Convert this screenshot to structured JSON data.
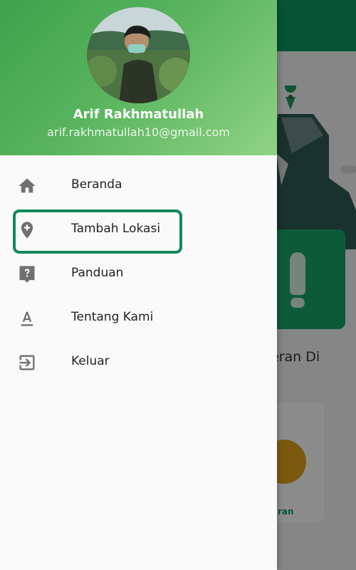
{
  "user": {
    "name": "Arif Rakhmatullah",
    "email": "arif.rakhmatullah10@gmail.com"
  },
  "menu": {
    "items": [
      {
        "label": "Beranda",
        "icon": "home-icon"
      },
      {
        "label": "Tambah Lokasi",
        "icon": "add-location-icon",
        "highlighted": true
      },
      {
        "label": "Panduan",
        "icon": "help-icon"
      },
      {
        "label": "Tentang Kami",
        "icon": "text-format-icon"
      },
      {
        "label": "Keluar",
        "icon": "logout-icon"
      }
    ]
  },
  "background": {
    "section_text_partial": "eran Di",
    "card_label_partial": "ran"
  },
  "colors": {
    "header_gradient_start": "#3fa24c",
    "header_gradient_end": "#8fd384",
    "primary_green": "#0b9a62",
    "highlight_border": "#138a5b",
    "icon_gray": "#707070"
  }
}
